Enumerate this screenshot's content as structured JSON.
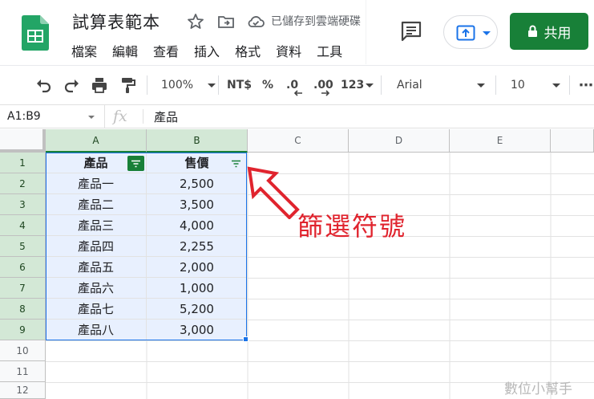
{
  "app": {
    "title": "試算表範本",
    "save_status": "已儲存到雲端硬碟",
    "menu": [
      "檔案",
      "編輯",
      "查看",
      "插入",
      "格式",
      "資料",
      "工具"
    ],
    "share_label": "共用"
  },
  "toolbar": {
    "zoom": "100%",
    "currency": "NT$",
    "percent": "%",
    "decrease_decimal": ".0",
    "increase_decimal": ".00",
    "more_formats": "123",
    "font": "Arial",
    "font_size": "10",
    "more": "⋯"
  },
  "formula_bar": {
    "name_box": "A1:B9",
    "fx": "fx",
    "value": "產品"
  },
  "sheet": {
    "columns": [
      "A",
      "B",
      "C",
      "D",
      "E"
    ],
    "rows": [
      "1",
      "2",
      "3",
      "4",
      "5",
      "6",
      "7",
      "8",
      "9",
      "10",
      "11",
      "12"
    ],
    "header": [
      "產品",
      "售價"
    ],
    "data": [
      [
        "產品一",
        "2,500"
      ],
      [
        "產品二",
        "3,500"
      ],
      [
        "產品三",
        "4,000"
      ],
      [
        "產品四",
        "2,255"
      ],
      [
        "產品五",
        "2,000"
      ],
      [
        "產品六",
        "1,000"
      ],
      [
        "產品七",
        "5,200"
      ],
      [
        "產品八",
        "3,000"
      ]
    ]
  },
  "annotation": {
    "text": "篩選符號",
    "color": "#e0242e"
  },
  "watermark": "數位小幫手",
  "colors": {
    "brand_green": "#188038",
    "selection_blue": "#1a73e8",
    "selection_fill": "#e8f0fe",
    "header_selected": "#d3e8d6"
  }
}
